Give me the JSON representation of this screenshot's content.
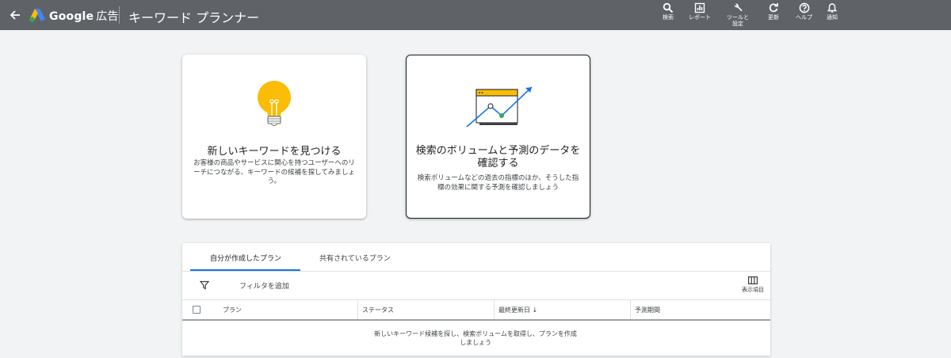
{
  "header": {
    "brand": "Google",
    "brand_sub": "広告",
    "tool_title": "キーワード プランナー",
    "buttons": [
      {
        "label": "検索",
        "icon": "search-icon"
      },
      {
        "label": "レポート",
        "icon": "reports-icon"
      },
      {
        "label": "ツールと\n設定",
        "icon": "wrench-icon"
      },
      {
        "label": "更新",
        "icon": "refresh-icon"
      },
      {
        "label": "ヘルプ",
        "icon": "help-icon"
      },
      {
        "label": "通知",
        "icon": "bell-icon"
      }
    ]
  },
  "cards": [
    {
      "title": "新しいキーワードを見つける",
      "description": "お客様の商品やサービスに関心を持つユーザーへのリーチにつながる、キーワードの候補を探してみましょう。",
      "icon": "lightbulb-icon"
    },
    {
      "title": "検索のボリュームと予測のデータを確認する",
      "description": "検索ボリュームなどの過去の指標のほか、そうした指標の効果に関する予測を確認しましょう",
      "icon": "forecast-chart-icon"
    }
  ],
  "plans": {
    "tabs": [
      "自分が作成したプラン",
      "共有されているプラン"
    ],
    "active_tab": 0,
    "filter_label": "フィルタを追加",
    "columns_button": "表示項目",
    "columns": [
      "プラン",
      "ステータス",
      "最終更新日",
      "予測期間"
    ],
    "sort_indicator": "↓",
    "empty_message": "新しいキーワード候補を探し、検索ボリュームを取得し、プランを作成しましょう"
  },
  "colors": {
    "topbar": "#5f6368",
    "accent": "#1a73e8",
    "bulb": "#fbbc04",
    "chart_arrow": "#1a73e8",
    "chart_point": "#34a853"
  }
}
